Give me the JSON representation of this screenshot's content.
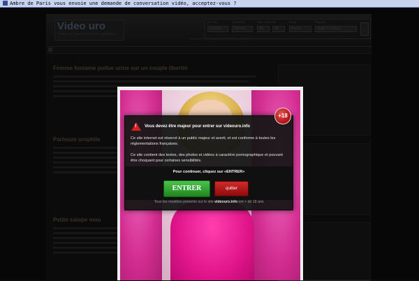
{
  "notification": {
    "text": "Ambre de Paris vous envoie une demande de conversation vidéo, acceptez-vous ?"
  },
  "site": {
    "title": "Video uro",
    "tagline": "Vidéos de sexe uro et pisse gratuites",
    "filter_labels": [
      "Je suis",
      "Cherche",
      "Age entre",
      "et",
      "Pays",
      "Région"
    ],
    "filter_values": [
      "Homme",
      "Femme",
      "18",
      "99",
      "France",
      "Toute la France"
    ],
    "filter_note": "Rencontres x réelles près de chez vous"
  },
  "articles": [
    {
      "title": "Femme fontaine poilue urine sur un couple libertin"
    },
    {
      "title": "Partouze urophile"
    },
    {
      "title": "Petite salope mou"
    }
  ],
  "modal": {
    "badge": "+18",
    "warn_glyph": "!",
    "title": "Vous devez être majeur pour entrer sur videouro.info",
    "paragraph1": "Ce site internet est réservé à un public majeur et averti, et est conforme à toutes les réglementations françaises.",
    "paragraph2": "Ce site contient des textes, des photos et vidéos à caractère pornographique et pouvant être choquant pour certaines sensibilités.",
    "cta": "Pour continuer, cliquez sur «ENTRER»",
    "enter_label": "ENTRER",
    "quit_label": "quitter",
    "footer_prefix": "Tous les modèles présents sur le site",
    "footer_site": "videouro.info",
    "footer_suffix": "ont + de 18 ans"
  }
}
